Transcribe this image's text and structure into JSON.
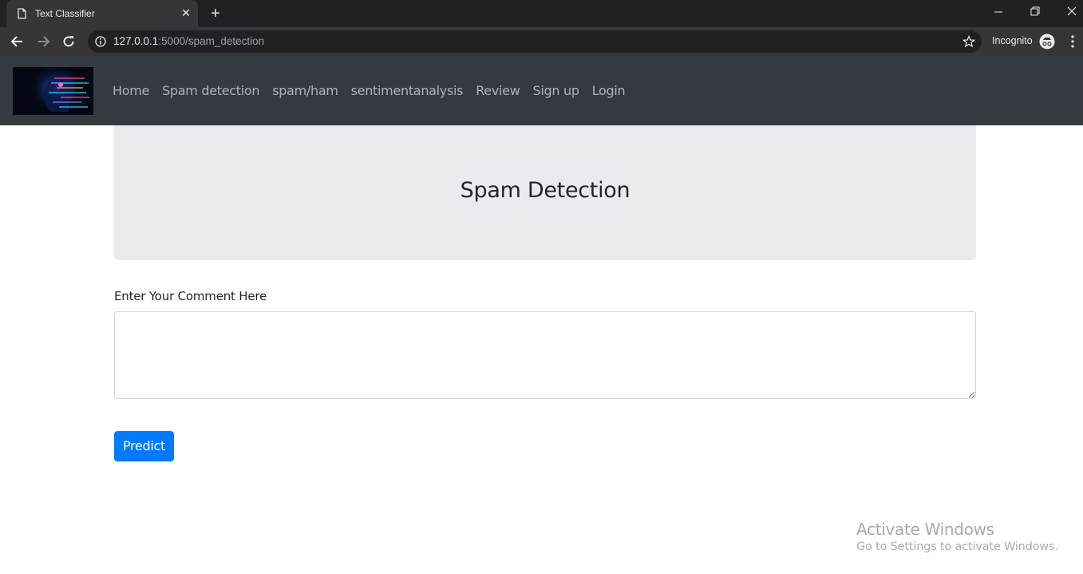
{
  "browser": {
    "tab_title": "Text Classifier",
    "tab_close": "✕",
    "new_tab": "+",
    "url_host": "127.0.0.1",
    "url_rest": ":5000/spam_detection",
    "incognito_label": "Incognito"
  },
  "navbar": {
    "links": [
      "Home",
      "Spam detection",
      "spam/ham",
      "sentimentanalysis",
      "Review",
      "Sign up",
      "Login"
    ]
  },
  "jumbotron": {
    "title": "Spam Detection"
  },
  "form": {
    "label": "Enter Your Comment Here",
    "comment_value": "",
    "submit_label": "Predict"
  },
  "watermark": {
    "title": "Activate Windows",
    "subtitle": "Go to Settings to activate Windows."
  },
  "colors": {
    "navbar_bg": "#343a40",
    "jumbotron_bg": "#e9ecef",
    "primary": "#007bff"
  }
}
